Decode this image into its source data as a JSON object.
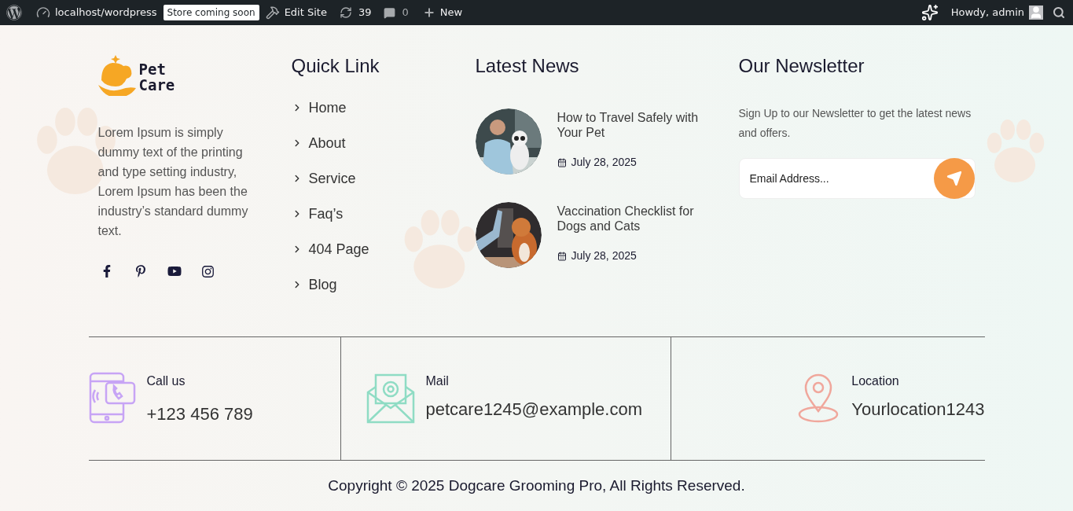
{
  "admin_bar": {
    "site": "localhost/wordpress",
    "badge": "Store coming soon",
    "edit_site": "Edit Site",
    "updates": "39",
    "comments": "0",
    "new": "New",
    "greeting": "Howdy, admin"
  },
  "brand": {
    "logo_line_1": "Pet",
    "logo_line_2": "Care",
    "about": "Lorem Ipsum is simply dummy text of the printing and type setting industry, Lorem Ipsum has been the industry’s standard dummy text.",
    "social": [
      {
        "kind": "facebook"
      },
      {
        "kind": "pinterest"
      },
      {
        "kind": "youtube"
      },
      {
        "kind": "instagram"
      }
    ]
  },
  "quick_links": {
    "title": "Quick Link",
    "items": [
      "Home",
      "About",
      "Service",
      "Faq’s",
      "404 Page",
      "Blog"
    ]
  },
  "latest_news": {
    "title": "Latest News",
    "posts": [
      {
        "title": "How to Travel Safely with Your Pet",
        "date": "July 28, 2025",
        "kind": "picture"
      },
      {
        "title": "Vaccination Checklist for Dogs and Cats",
        "date": "July 28, 2025",
        "kind": "picture"
      }
    ]
  },
  "newsletter": {
    "title": "Our Newsletter",
    "text": "Sign Up to our Newsletter to get the latest news and offers.",
    "placeholder": "Email Address..."
  },
  "contacts": [
    {
      "kind": "phone",
      "label": "Call us",
      "value": "+123 456 789"
    },
    {
      "kind": "mail",
      "label": "Mail",
      "value": "petcare1245@example.com"
    },
    {
      "kind": "location",
      "label": "Location",
      "value": "Yourlocation1243"
    }
  ],
  "copyright": "Copyright © 2025 Dogcare Grooming Pro, All Rights Reserved."
}
